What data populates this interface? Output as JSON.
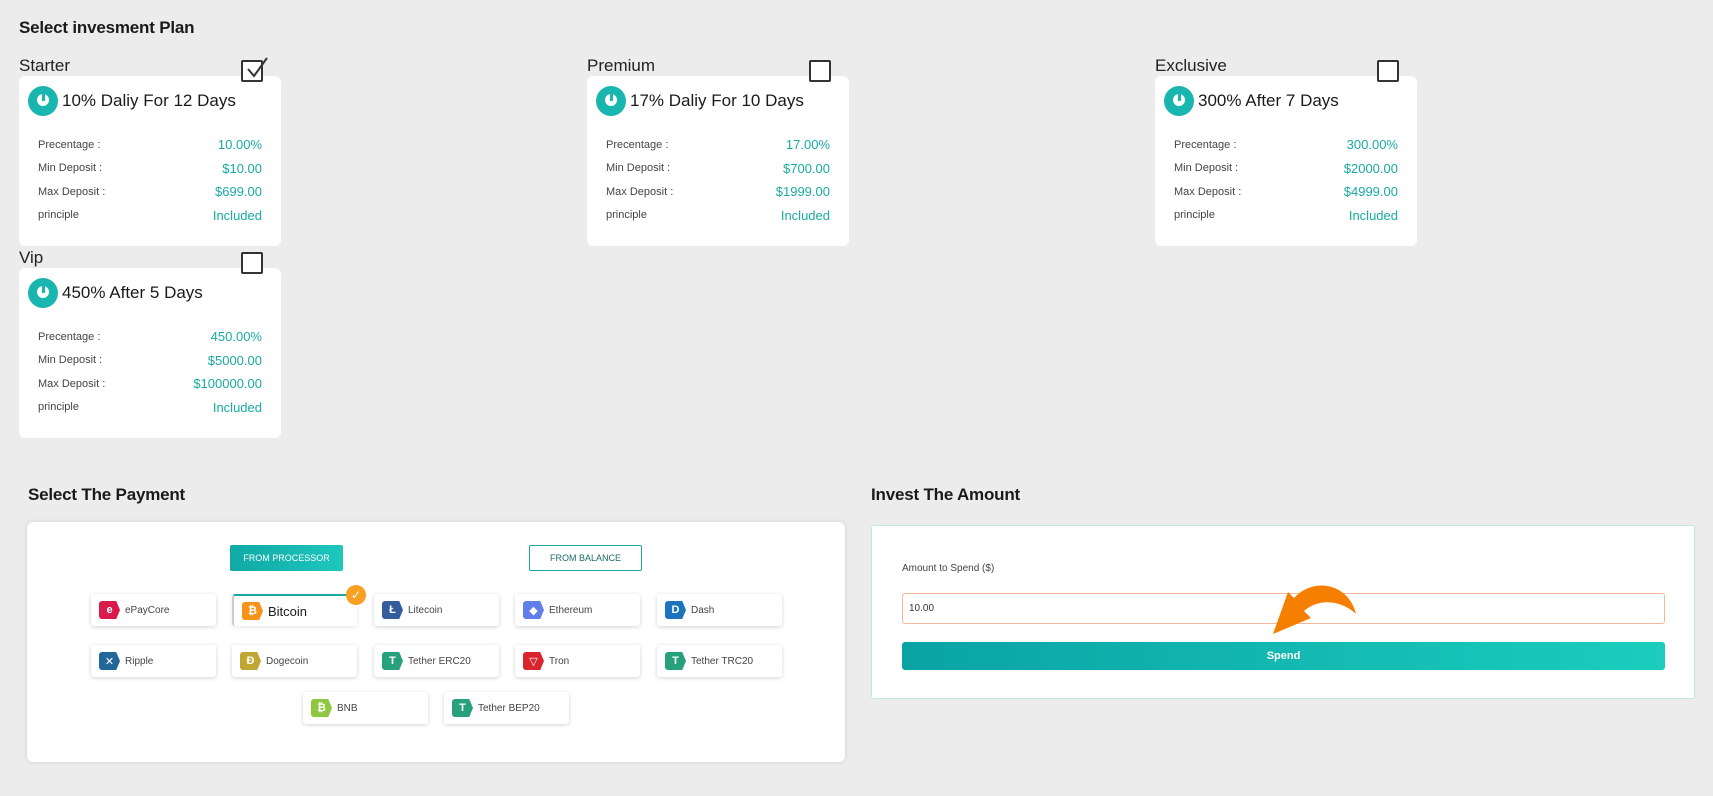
{
  "headings": {
    "plan": "Select invesment Plan",
    "payment": "Select The Payment",
    "invest": "Invest The Amount"
  },
  "plans": [
    {
      "name": "Starter",
      "title": "10% Daliy For 12 Days",
      "checked": true,
      "rows": [
        [
          "Precentage :",
          "10.00%"
        ],
        [
          "Min Deposit :",
          "$10.00"
        ],
        [
          "Max Deposit :",
          "$699.00"
        ],
        [
          "principle",
          "Included"
        ]
      ]
    },
    {
      "name": "Premium",
      "title": "17% Daliy For 10 Days",
      "checked": false,
      "rows": [
        [
          "Precentage :",
          "17.00%"
        ],
        [
          "Min Deposit :",
          "$700.00"
        ],
        [
          "Max Deposit :",
          "$1999.00"
        ],
        [
          "principle",
          "Included"
        ]
      ]
    },
    {
      "name": "Exclusive",
      "title": "300% After 7 Days",
      "checked": false,
      "rows": [
        [
          "Precentage :",
          "300.00%"
        ],
        [
          "Min Deposit :",
          "$2000.00"
        ],
        [
          "Max Deposit :",
          "$4999.00"
        ],
        [
          "principle",
          "Included"
        ]
      ]
    },
    {
      "name": "Vip",
      "title": "450% After 5 Days",
      "checked": false,
      "rows": [
        [
          "Precentage :",
          "450.00%"
        ],
        [
          "Min Deposit :",
          "$5000.00"
        ],
        [
          "Max Deposit :",
          "$100000.00"
        ],
        [
          "principle",
          "Included"
        ]
      ]
    }
  ],
  "payment": {
    "from_processor": "FROM PROCESSOR",
    "from_balance": "FROM BALANCE",
    "coins": [
      {
        "label": "ePayCore",
        "icon": "epaycore-icon",
        "color": "#d81b4a",
        "glyph": "e"
      },
      {
        "label": "Bitcoin",
        "icon": "bitcoin-icon",
        "color": "#f7931a",
        "glyph": "₿",
        "selected": true
      },
      {
        "label": "Litecoin",
        "icon": "litecoin-icon",
        "color": "#345d9d",
        "glyph": "Ł"
      },
      {
        "label": "Ethereum",
        "icon": "ethereum-icon",
        "color": "#627eea",
        "glyph": "◆"
      },
      {
        "label": "Dash",
        "icon": "dash-icon",
        "color": "#1c75bc",
        "glyph": "D"
      },
      {
        "label": "Ripple",
        "icon": "ripple-icon",
        "color": "#23669a",
        "glyph": "✕"
      },
      {
        "label": "Dogecoin",
        "icon": "dogecoin-icon",
        "color": "#c2a633",
        "glyph": "Đ"
      },
      {
        "label": "Tether ERC20",
        "icon": "tether-icon",
        "color": "#26a17b",
        "glyph": "T"
      },
      {
        "label": "Tron",
        "icon": "tron-icon",
        "color": "#d9232d",
        "glyph": "▽"
      },
      {
        "label": "Tether TRC20",
        "icon": "tether-icon",
        "color": "#26a17b",
        "glyph": "T"
      },
      {
        "label": "BNB",
        "icon": "bnb-icon",
        "color": "#8dc63f",
        "glyph": "₿"
      },
      {
        "label": "Tether BEP20",
        "icon": "tether-icon",
        "color": "#26a17b",
        "glyph": "T"
      }
    ]
  },
  "invest": {
    "amount_label": "Amount to Spend ($)",
    "amount_value": "10.00",
    "spend_label": "Spend"
  },
  "colors": {
    "accent": "#19aaa5",
    "arrow": "#f77f00",
    "check": "#f8a022"
  }
}
